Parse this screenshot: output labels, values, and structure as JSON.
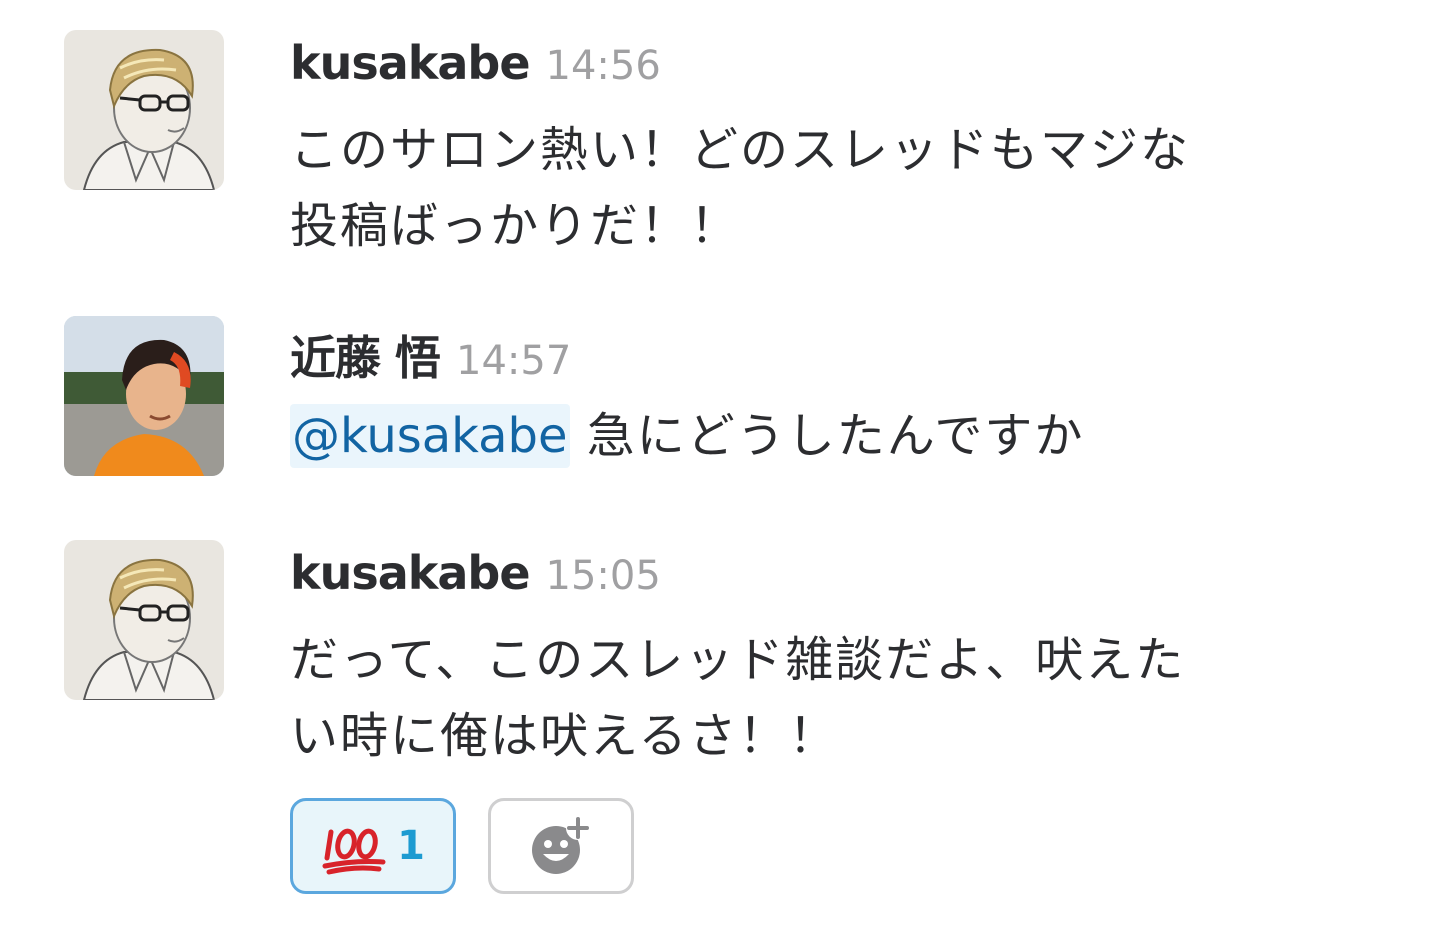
{
  "messages": [
    {
      "author": "kusakabe",
      "time": "14:56",
      "avatar_icon": "sketch-portrait-avatar",
      "lines": [
        "このサロン熱い！どのスレッドもマジな",
        "投稿ばっかりだ！！"
      ]
    },
    {
      "author": "近藤 悟",
      "time": "14:57",
      "avatar_icon": "photo-portrait-avatar",
      "mention": "@kusakabe",
      "text": "急にどうしたんですか"
    },
    {
      "author": "kusakabe",
      "time": "15:05",
      "avatar_icon": "sketch-portrait-avatar",
      "lines": [
        "だって、このスレッド雑談だよ、吠えた",
        "い時に俺は吠えるさ！！"
      ]
    }
  ],
  "reactions": [
    {
      "emoji": "💯",
      "icon": "hundred-points-icon",
      "count": "1"
    }
  ],
  "add_reaction_icon": "add-reaction-icon",
  "colors": {
    "text": "#2c2d30",
    "timestamp": "#a0a0a2",
    "mention_bg": "#eaf5fc",
    "mention_text": "#1264a3",
    "reaction_border": "#5ba7de",
    "reaction_bg": "#e8f5fa",
    "reaction_count": "#1d9bd1"
  }
}
